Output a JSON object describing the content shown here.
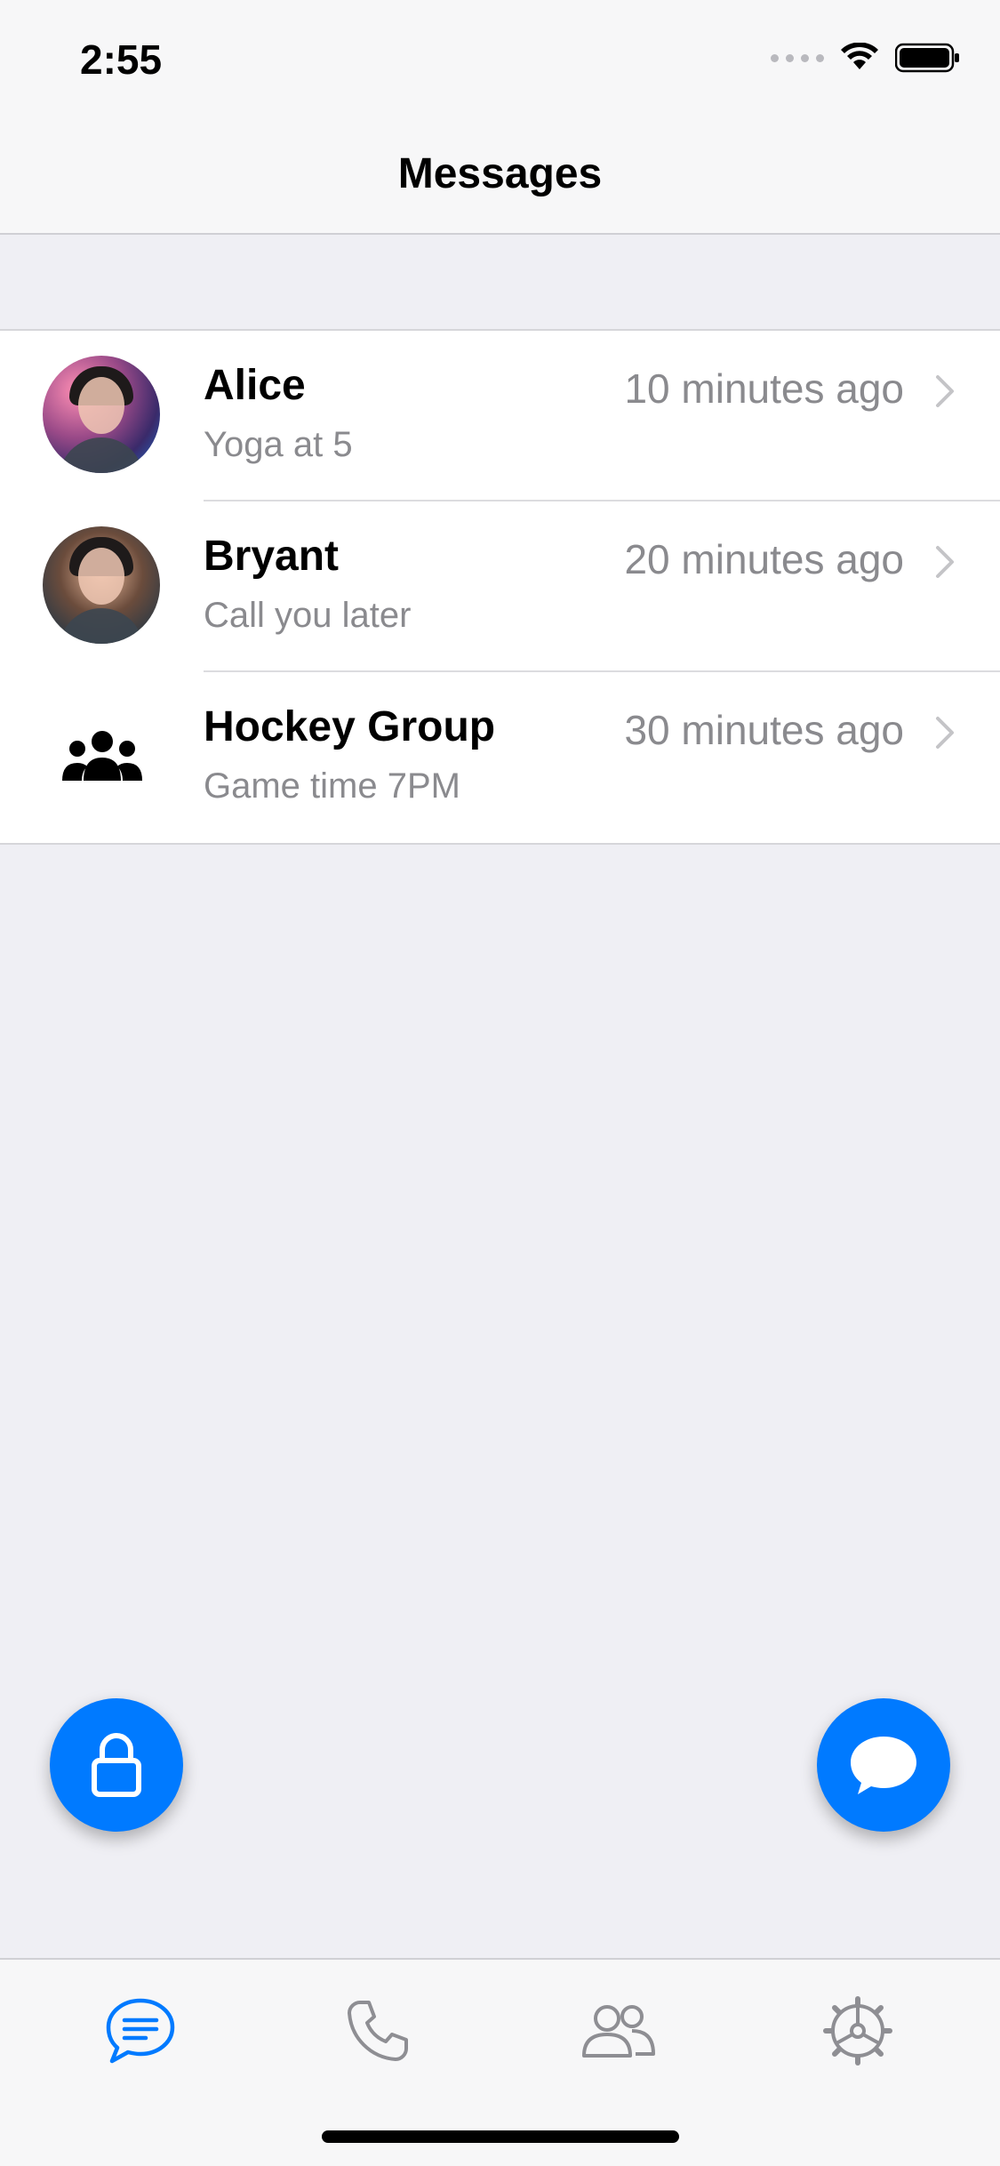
{
  "status_bar": {
    "time": "2:55"
  },
  "nav": {
    "title": "Messages"
  },
  "conversations": [
    {
      "name": "Alice",
      "preview": "Yoga at 5",
      "time": "10 minutes ago",
      "avatar": "photo"
    },
    {
      "name": "Bryant",
      "preview": "Call you later",
      "time": "20 minutes ago",
      "avatar": "photo"
    },
    {
      "name": "Hockey Group",
      "preview": "Game time 7PM",
      "time": "30 minutes ago",
      "avatar": "group-icon"
    }
  ],
  "fabs": {
    "left_icon": "lock-icon",
    "right_icon": "chat-bubble-icon"
  },
  "tabbar": {
    "tabs": [
      {
        "icon": "message-icon",
        "active": true
      },
      {
        "icon": "phone-icon",
        "active": false
      },
      {
        "icon": "contacts-icon",
        "active": false
      },
      {
        "icon": "settings-icon",
        "active": false
      }
    ]
  },
  "colors": {
    "accent": "#007aff",
    "secondary_text": "#8a8a8e",
    "background": "#efeff4",
    "inactive_icon": "#8e8e93"
  }
}
